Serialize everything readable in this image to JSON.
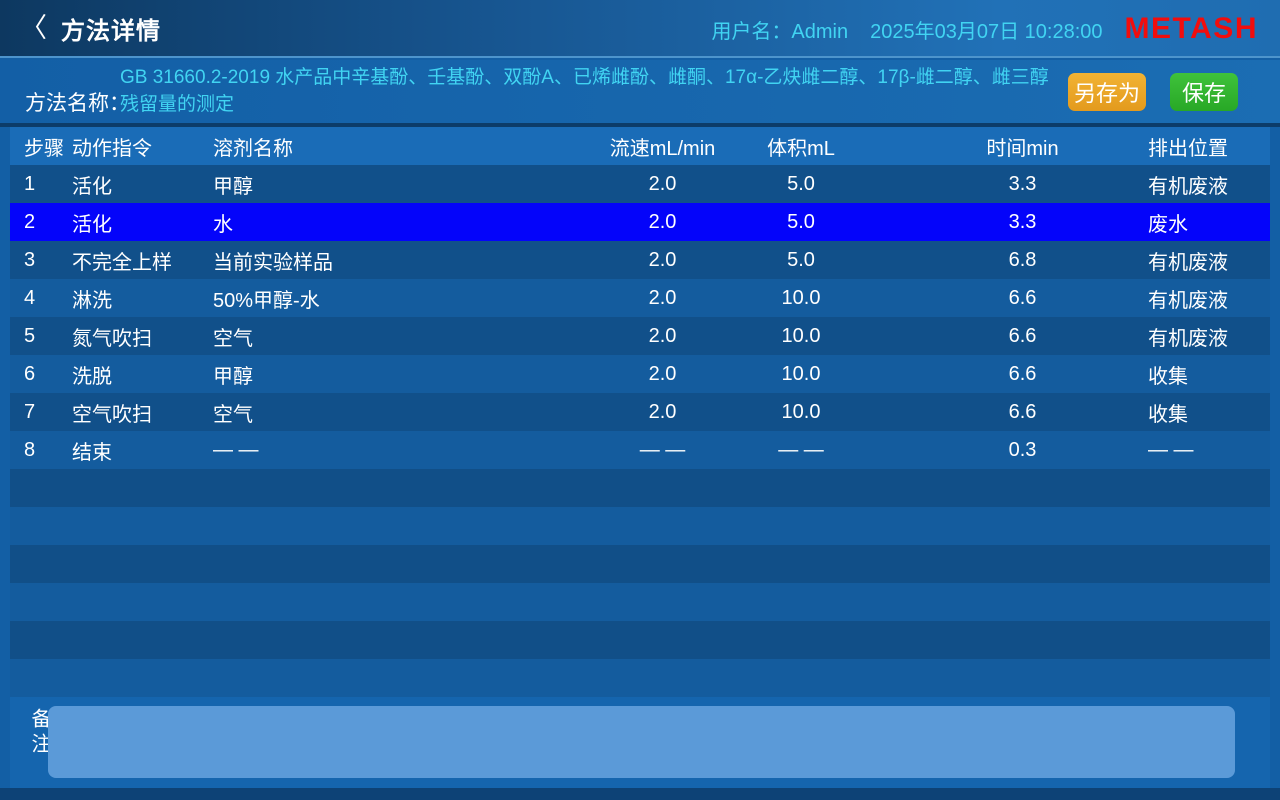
{
  "titlebar": {
    "back_glyph": "〈",
    "title": "方法详情",
    "user_label": "用户名：Admin",
    "datetime": "2025年03月07日 10:28:00",
    "logo": "METASH"
  },
  "method": {
    "label": "方法名称：",
    "name": "GB 31660.2-2019  水产品中辛基酚、壬基酚、双酚A、已烯雌酚、雌酮、17α-乙炔雌二醇、17β-雌二醇、雌三醇残留量的测定",
    "save_as_label": "另存为",
    "save_label": "保存"
  },
  "table": {
    "columns": [
      "步骤",
      "动作指令",
      "溶剂名称",
      "流速mL/min",
      "体积mL",
      "时间min",
      "排出位置"
    ],
    "selected_step": "2",
    "rows": [
      [
        "1",
        "活化",
        "甲醇",
        "2.0",
        "5.0",
        "3.3",
        "有机废液"
      ],
      [
        "2",
        "活化",
        "水",
        "2.0",
        "5.0",
        "3.3",
        "废水"
      ],
      [
        "3",
        "不完全上样",
        "当前实验样品",
        "2.0",
        "5.0",
        "6.8",
        "有机废液"
      ],
      [
        "4",
        "淋洗",
        "50%甲醇-水",
        "2.0",
        "10.0",
        "6.6",
        "有机废液"
      ],
      [
        "5",
        "氮气吹扫",
        "空气",
        "2.0",
        "10.0",
        "6.6",
        "有机废液"
      ],
      [
        "6",
        "洗脱",
        "甲醇",
        "2.0",
        "10.0",
        "6.6",
        "收集"
      ],
      [
        "7",
        "空气吹扫",
        "空气",
        "2.0",
        "10.0",
        "6.6",
        "收集"
      ],
      [
        "8",
        "结束",
        "— —",
        "— —",
        "— —",
        "0.3",
        "— —"
      ]
    ],
    "empty_stripe_count": 6
  },
  "notes": {
    "label": "备注",
    "value": "",
    "placeholder": ""
  },
  "colors": {
    "selected_row": "#0404FA",
    "save_as_button": "#E9A326",
    "save_button": "#2FB42C",
    "logo_red": "#F20D0D",
    "accent_cyan": "#41D4F2"
  }
}
